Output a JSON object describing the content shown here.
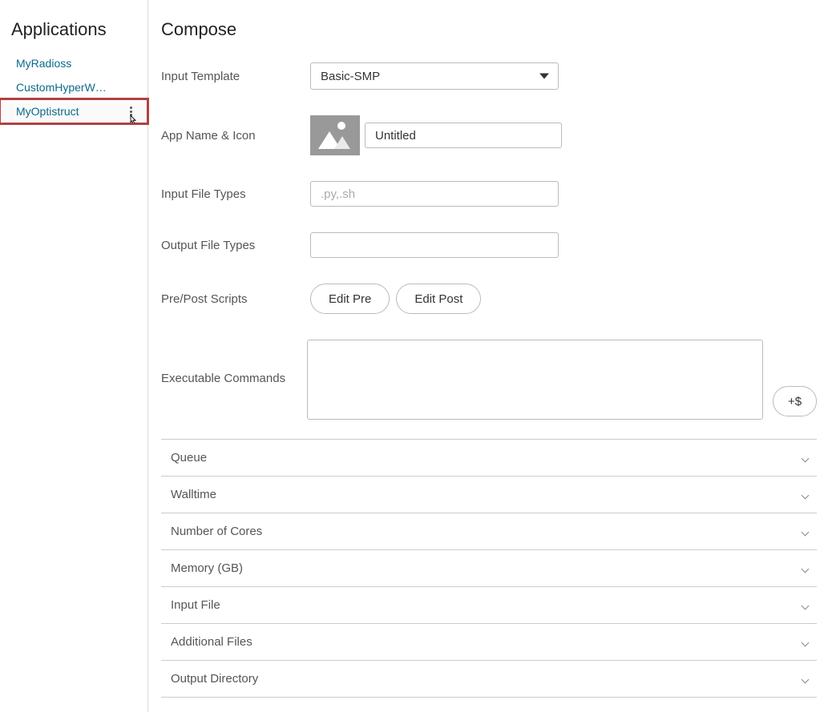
{
  "sidebar": {
    "title": "Applications",
    "items": [
      {
        "label": "MyRadioss"
      },
      {
        "label": "CustomHyperW…"
      },
      {
        "label": "MyOptistruct"
      }
    ]
  },
  "main": {
    "title": "Compose",
    "labels": {
      "input_template": "Input Template",
      "app_name_icon": "App Name & Icon",
      "input_file_types": "Input File Types",
      "output_file_types": "Output File Types",
      "pre_post": "Pre/Post Scripts",
      "exec_cmds": "Executable Commands"
    },
    "values": {
      "input_template": "Basic-SMP",
      "app_name": "Untitled",
      "input_file_types": "",
      "input_file_types_placeholder": ".py,.sh",
      "output_file_types": "",
      "exec_cmds": ""
    },
    "buttons": {
      "edit_pre": "Edit Pre",
      "edit_post": "Edit Post",
      "add_var": "+$"
    },
    "accordion": [
      "Queue",
      "Walltime",
      "Number of Cores",
      "Memory (GB)",
      "Input File",
      "Additional Files",
      "Output Directory"
    ]
  }
}
